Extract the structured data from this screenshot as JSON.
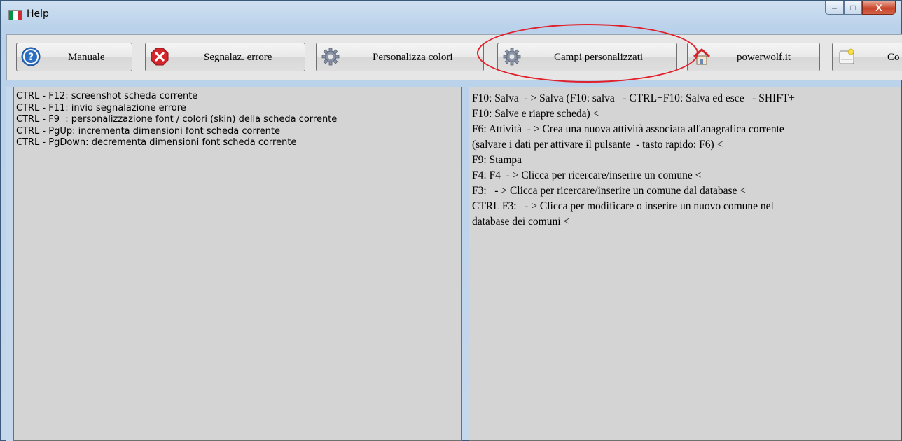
{
  "window": {
    "title": "Help",
    "flag_colors": [
      "#009246",
      "#ffffff",
      "#ce2b37"
    ],
    "controls": {
      "minimize": "–",
      "maximize": "□",
      "close": "X"
    }
  },
  "toolbar": {
    "buttons": [
      {
        "label": "Manuale",
        "icon": "help-icon"
      },
      {
        "label": "Segnalaz. errore",
        "icon": "error-icon"
      },
      {
        "label": "Personalizza colori",
        "icon": "gear-icon"
      },
      {
        "label": "Campi personalizzati",
        "icon": "gear-icon"
      },
      {
        "label": "powerwolf.it",
        "icon": "home-icon"
      },
      {
        "label": "Co",
        "icon": "note-icon"
      }
    ],
    "highlight_color": "#e0202a"
  },
  "left_pane": {
    "lines": [
      "CTRL - F12: screenshot scheda corrente",
      "CTRL - F11: invio segnalazione errore",
      "CTRL - F9  : personalizzazione font / colori (skin) della scheda corrente",
      "CTRL - PgUp: incrementa dimensioni font scheda corrente",
      "CTRL - PgDown: decrementa dimensioni font scheda corrente"
    ]
  },
  "right_pane": {
    "lines": [
      "F10: Salva  - > Salva (F10: salva   - CTRL+F10: Salva ed esce   - SHIFT+",
      "F10: Salve e riapre scheda) <",
      "F6: Attività  - > Crea una nuova attività associata all'anagrafica corrente",
      "(salvare i dati per attivare il pulsante  - tasto rapido: F6) <",
      "F9: Stampa",
      "F4: F4  - > Clicca per ricercare/inserire un comune <",
      "F3:   - > Clicca per ricercare/inserire un comune dal database <",
      "CTRL F3:   - > Clicca per modificare o inserire un nuovo comune nel",
      "database dei comuni <"
    ]
  }
}
